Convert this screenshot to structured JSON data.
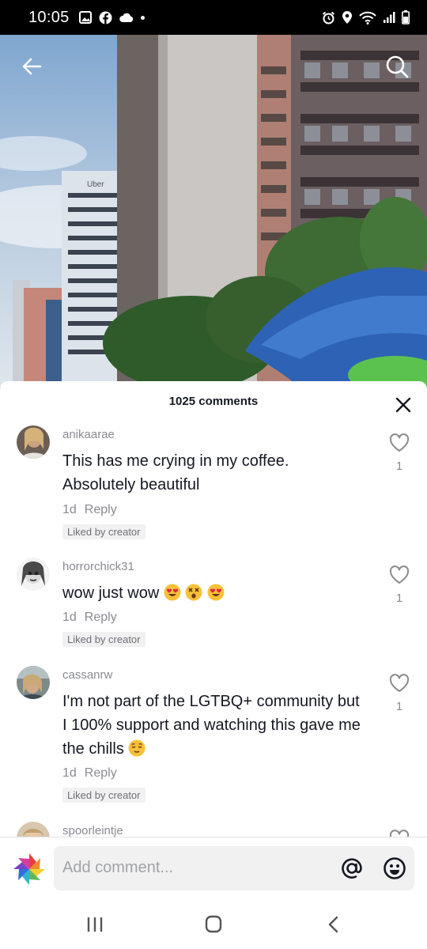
{
  "status_bar": {
    "time": "10:05"
  },
  "video": {
    "sign_text": "Uber"
  },
  "comments_panel": {
    "count_label": "1025 comments",
    "comments": [
      {
        "username": "anikaarae",
        "text": "This has me crying in my coffee. Absolutely beautiful",
        "emojis": [],
        "age": "1d",
        "reply_label": "Reply",
        "badge": "Liked by creator",
        "like_count": "1"
      },
      {
        "username": "horrorchick31",
        "text": "wow just wow",
        "emojis": [
          "heart-eyes",
          "dizzy-face",
          "heart-eyes"
        ],
        "age": "1d",
        "reply_label": "Reply",
        "badge": "Liked by creator",
        "like_count": "1"
      },
      {
        "username": "cassanrw",
        "text": "I'm not part of the LGTBQ+ community but I 100% support and watching this gave me the chills",
        "emojis": [
          "relieved-face"
        ],
        "age": "1d",
        "reply_label": "Reply",
        "badge": "Liked by creator",
        "like_count": "1"
      },
      {
        "username": "spoorleintje"
      }
    ]
  },
  "composer": {
    "placeholder": "Add comment..."
  }
}
